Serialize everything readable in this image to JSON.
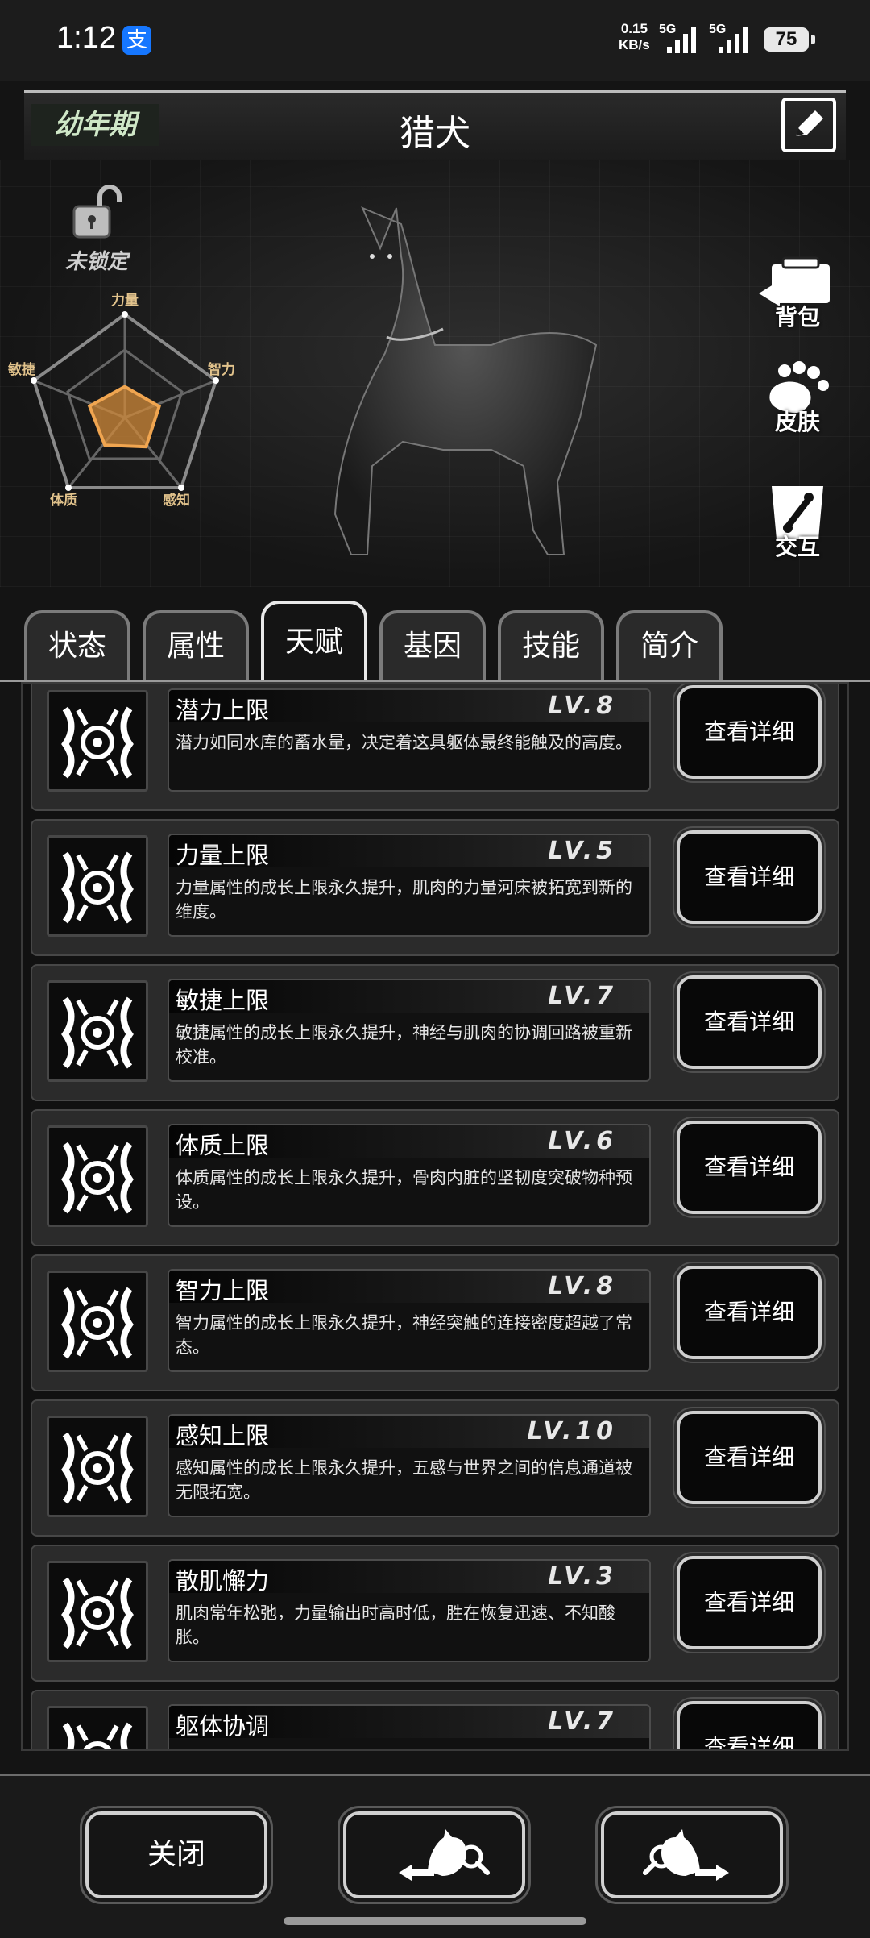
{
  "status_bar": {
    "time": "1:12",
    "app_icon": "支",
    "net_speed_value": "0.15",
    "net_speed_unit": "KB/s",
    "network_1": "5G",
    "network_2": "5G",
    "battery": "75"
  },
  "header": {
    "stage": "幼年期",
    "title": "猎犬",
    "edit_icon": "edit-icon"
  },
  "lock": {
    "label": "未锁定"
  },
  "radar": {
    "labels": {
      "strength": "力量",
      "intelligence": "智力",
      "perception": "感知",
      "constitution": "体质",
      "agility": "敏捷"
    },
    "fill_color": "#d08a3a",
    "values_fraction": {
      "strength": 0.3,
      "intelligence": 0.35,
      "perception": 0.35,
      "constitution": 0.33,
      "agility": 0.36
    }
  },
  "side_buttons": {
    "backpack": "背包",
    "skin": "皮肤",
    "interact": "交互"
  },
  "tabs": [
    "状态",
    "属性",
    "天赋",
    "基因",
    "技能",
    "简介"
  ],
  "active_tab": "天赋",
  "talents": [
    {
      "name": "潜力上限",
      "level": "LV.8",
      "desc": "潜力如同水库的蓄水量，决定着这具躯体最终能触及的高度。",
      "button": "查看详细"
    },
    {
      "name": "力量上限",
      "level": "LV.5",
      "desc": "力量属性的成长上限永久提升，肌肉的力量河床被拓宽到新的维度。",
      "button": "查看详细"
    },
    {
      "name": "敏捷上限",
      "level": "LV.7",
      "desc": "敏捷属性的成长上限永久提升，神经与肌肉的协调回路被重新校准。",
      "button": "查看详细"
    },
    {
      "name": "体质上限",
      "level": "LV.6",
      "desc": "体质属性的成长上限永久提升，骨肉内脏的坚韧度突破物种预设。",
      "button": "查看详细"
    },
    {
      "name": "智力上限",
      "level": "LV.8",
      "desc": "智力属性的成长上限永久提升，神经突触的连接密度超越了常态。",
      "button": "查看详细"
    },
    {
      "name": "感知上限",
      "level": "LV.10",
      "desc": "感知属性的成长上限永久提升，五感与世界之间的信息通道被无限拓宽。",
      "button": "查看详细"
    },
    {
      "name": "散肌懈力",
      "level": "LV.3",
      "desc": "肌肉常年松弛，力量输出时高时低，胜在恢复迅速、不知酸胀。",
      "button": "查看详细"
    },
    {
      "name": "躯体协调",
      "level": "LV.7",
      "desc": "",
      "button": "查看详细"
    }
  ],
  "bottom": {
    "close": "关闭"
  }
}
